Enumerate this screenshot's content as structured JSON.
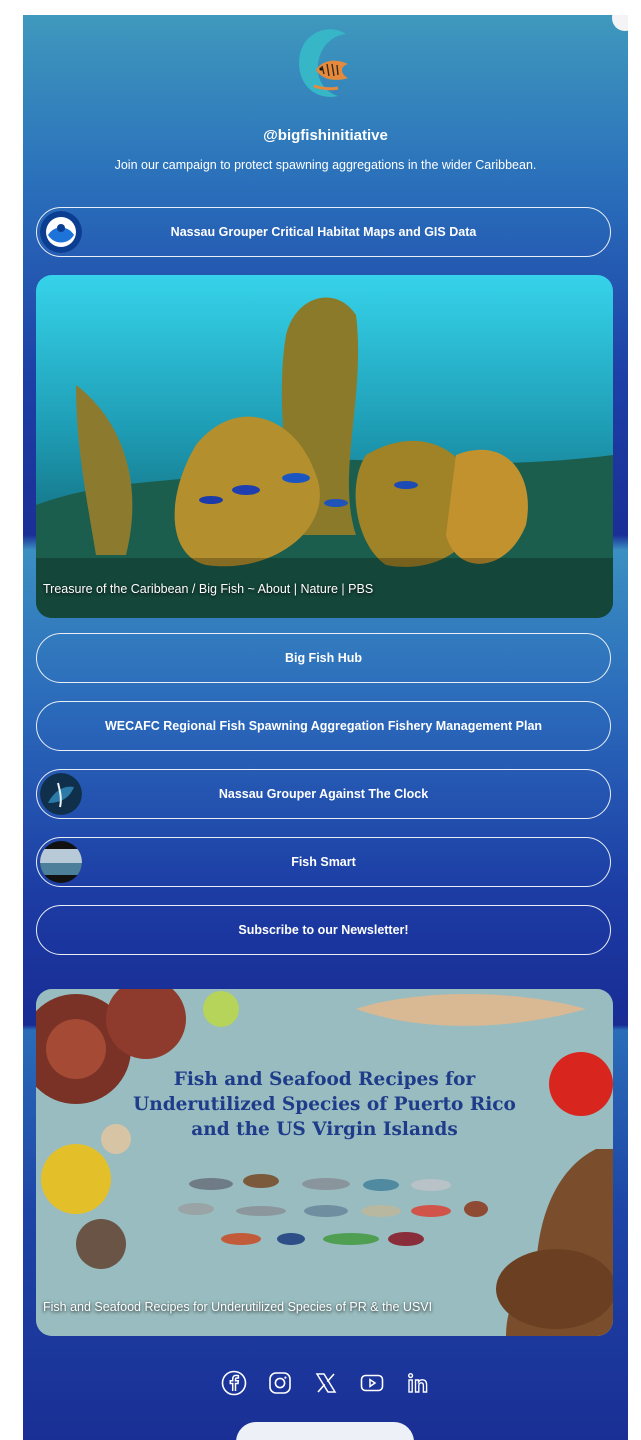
{
  "profile": {
    "handle": "@bigfishinitiative",
    "bio": "Join our campaign to protect spawning aggregations in the wider Caribbean."
  },
  "links": [
    {
      "label": "Nassau Grouper Critical Habitat Maps and GIS Data",
      "thumb": "noaa-logo"
    },
    {
      "label": "Big Fish Hub"
    },
    {
      "label": "WECAFC Regional Fish Spawning Aggregation Fishery Management Plan"
    },
    {
      "label": "Nassau Grouper Against The Clock",
      "thumb": "diver-photo"
    },
    {
      "label": "Fish Smart",
      "thumb": "ocean-photo"
    },
    {
      "label": "Subscribe to our Newsletter!"
    }
  ],
  "cards": [
    {
      "caption": "Treasure of the Caribbean / Big Fish ~ About | Nature | PBS"
    },
    {
      "caption": "Fish and Seafood Recipes for Underutilized Species of PR & the USVI",
      "poster_lines": [
        "Fish and Seafood Recipes for",
        "Underutilized Species of Puerto Rico",
        "and the US Virgin Islands"
      ]
    }
  ],
  "socials": [
    "facebook-icon",
    "instagram-icon",
    "x-icon",
    "youtube-icon",
    "linkedin-icon"
  ],
  "colors": {
    "accent_top": "#3f99bd",
    "accent_bottom": "#1a2f95",
    "button_border": "#e9eef8"
  }
}
